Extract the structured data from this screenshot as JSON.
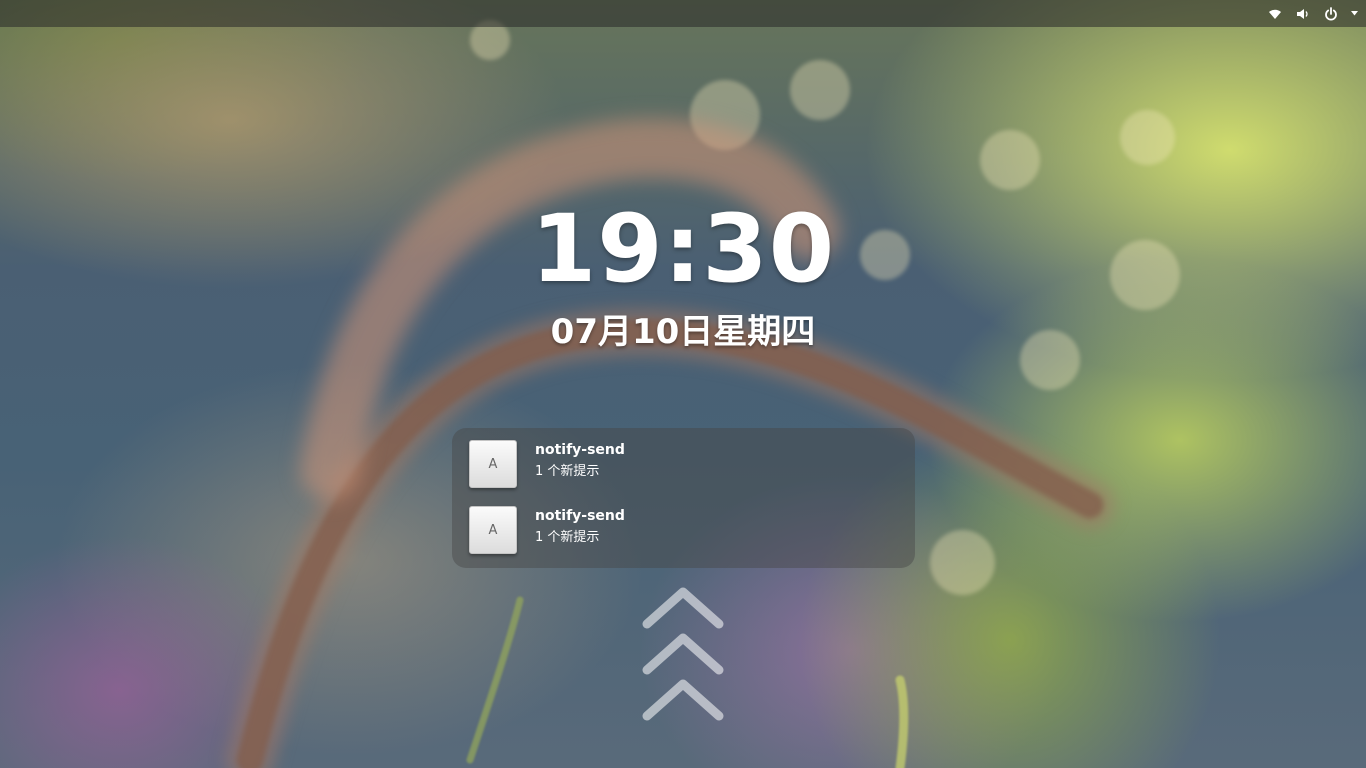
{
  "screen": "lock-screen",
  "top_panel": {
    "tray_icons": [
      "wifi-icon",
      "volume-icon",
      "power-icon",
      "dropdown-arrow-icon"
    ]
  },
  "clock": {
    "time": "19:30",
    "date": "07月10日星期四"
  },
  "notifications": [
    {
      "icon_letter": "A",
      "title": "notify-send",
      "body": "1 个新提示"
    },
    {
      "icon_letter": "A",
      "title": "notify-send",
      "body": "1 个新提示"
    }
  ],
  "unlock_hint": {
    "icon": "chevron-up-icon"
  }
}
